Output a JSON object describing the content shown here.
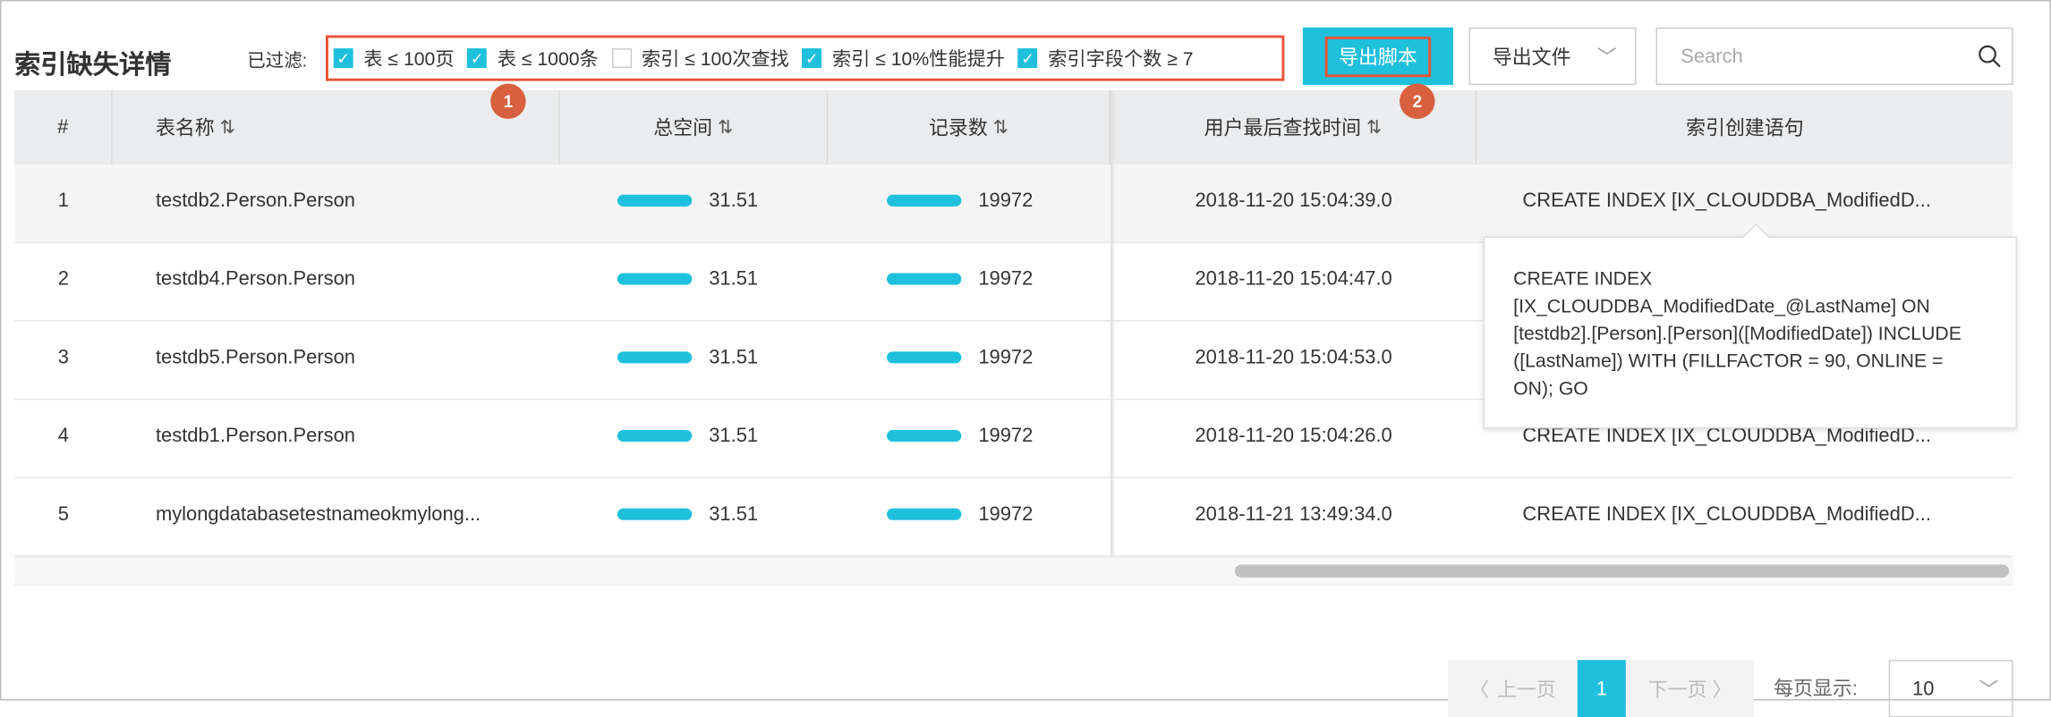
{
  "title": "索引缺失详情",
  "filter": {
    "label": "已过滤:",
    "items": [
      {
        "label": "表 ≤ 100页",
        "checked": true
      },
      {
        "label": "表 ≤ 1000条",
        "checked": true
      },
      {
        "label": "索引 ≤ 100次查找",
        "checked": false
      },
      {
        "label": "索引 ≤ 10%性能提升",
        "checked": true
      },
      {
        "label": "索引字段个数 ≥ 7",
        "checked": true
      }
    ]
  },
  "toolbar": {
    "export_script": "导出脚本",
    "export_file": "导出文件",
    "search_placeholder": "Search"
  },
  "badges": [
    "1",
    "2"
  ],
  "columns": [
    {
      "label": "#",
      "sortable": false
    },
    {
      "label": "表名称",
      "sortable": true
    },
    {
      "label": "总空间",
      "sortable": true
    },
    {
      "label": "记录数",
      "sortable": true
    },
    {
      "label": "用户最后查找时间",
      "sortable": true
    },
    {
      "label": "索引创建语句",
      "sortable": false
    }
  ],
  "sort_glyph": "⇅",
  "rows": [
    {
      "index": "1",
      "name": "testdb2.Person.Person",
      "space": "31.51",
      "records": "19972",
      "time": "2018-11-20 15:04:39.0",
      "stmt": "CREATE INDEX [IX_CLOUDDBA_ModifiedD..."
    },
    {
      "index": "2",
      "name": "testdb4.Person.Person",
      "space": "31.51",
      "records": "19972",
      "time": "2018-11-20 15:04:47.0",
      "stmt": "CREATE INDEX [IX_CLOUDDBA_ModifiedD..."
    },
    {
      "index": "3",
      "name": "testdb5.Person.Person",
      "space": "31.51",
      "records": "19972",
      "time": "2018-11-20 15:04:53.0",
      "stmt": "CREATE INDEX [IX_CLOUDDBA_ModifiedD..."
    },
    {
      "index": "4",
      "name": "testdb1.Person.Person",
      "space": "31.51",
      "records": "19972",
      "time": "2018-11-20 15:04:26.0",
      "stmt": "CREATE INDEX [IX_CLOUDDBA_ModifiedD..."
    },
    {
      "index": "5",
      "name": "mylongdatabasetestnameokmylong...",
      "space": "31.51",
      "records": "19972",
      "time": "2018-11-21 13:49:34.0",
      "stmt": "CREATE INDEX [IX_CLOUDDBA_ModifiedD..."
    }
  ],
  "tooltip": "CREATE INDEX [IX_CLOUDDBA_ModifiedDate_@LastName] ON [testdb2].[Person].[Person]([ModifiedDate]) INCLUDE ([LastName]) WITH (FILLFACTOR = 90, ONLINE = ON); GO",
  "pagination": {
    "prev": "上一页",
    "current": "1",
    "next": "下一页",
    "per_page_label": "每页显示:",
    "per_page": "10"
  },
  "colors": {
    "accent": "#1fc0dc",
    "annotation": "#e8553a",
    "badge": "#d9603f"
  }
}
